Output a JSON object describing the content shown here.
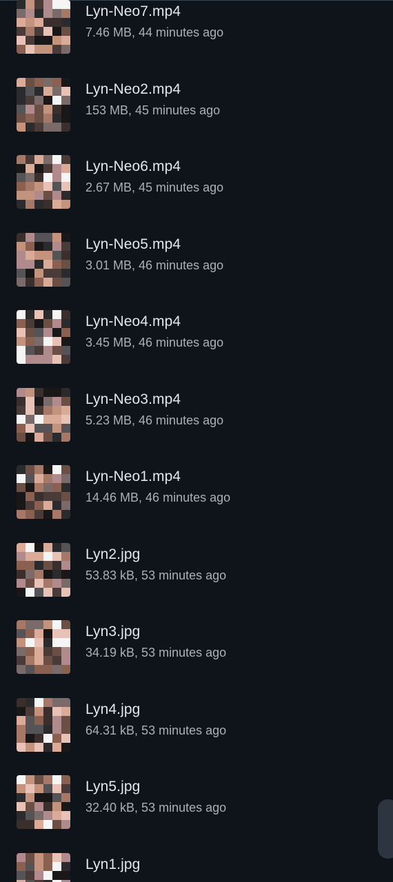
{
  "files": [
    {
      "name": "Lyn-Neo7.mp4",
      "meta": "7.46 MB, 44 minutes ago",
      "thumb_icon": "video-thumbnail-icon"
    },
    {
      "name": "Lyn-Neo2.mp4",
      "meta": "153 MB, 45 minutes ago",
      "thumb_icon": "video-thumbnail-icon"
    },
    {
      "name": "Lyn-Neo6.mp4",
      "meta": "2.67 MB, 45 minutes ago",
      "thumb_icon": "video-thumbnail-icon"
    },
    {
      "name": "Lyn-Neo5.mp4",
      "meta": "3.01 MB, 46 minutes ago",
      "thumb_icon": "video-thumbnail-icon"
    },
    {
      "name": "Lyn-Neo4.mp4",
      "meta": "3.45 MB, 46 minutes ago",
      "thumb_icon": "video-thumbnail-icon"
    },
    {
      "name": "Lyn-Neo3.mp4",
      "meta": "5.23 MB, 46 minutes ago",
      "thumb_icon": "video-thumbnail-icon"
    },
    {
      "name": "Lyn-Neo1.mp4",
      "meta": "14.46 MB, 46 minutes ago",
      "thumb_icon": "video-thumbnail-icon"
    },
    {
      "name": "Lyn2.jpg",
      "meta": "53.83 kB, 53 minutes ago",
      "thumb_icon": "image-thumbnail-icon"
    },
    {
      "name": "Lyn3.jpg",
      "meta": "34.19 kB, 53 minutes ago",
      "thumb_icon": "image-thumbnail-icon"
    },
    {
      "name": "Lyn4.jpg",
      "meta": "64.31 kB, 53 minutes ago",
      "thumb_icon": "image-thumbnail-icon"
    },
    {
      "name": "Lyn5.jpg",
      "meta": "32.40 kB, 53 minutes ago",
      "thumb_icon": "image-thumbnail-icon"
    },
    {
      "name": "Lyn1.jpg",
      "meta": "",
      "thumb_icon": "image-thumbnail-icon"
    }
  ],
  "colors": {
    "background": "#0e1419",
    "file_name": "#e3e6ea",
    "file_meta": "#a9b0b8",
    "scroll_handle": "#2c3540"
  },
  "pixelation_palette": [
    "#3b2f2e",
    "#6b4e44",
    "#8a6150",
    "#a57867",
    "#c4937e",
    "#d9ab98",
    "#1a1718",
    "#2b2b2e",
    "#555356",
    "#7a6a6a",
    "#b08a8c",
    "#e8c1b7",
    "#f5f5f5",
    "#4a3a38"
  ]
}
